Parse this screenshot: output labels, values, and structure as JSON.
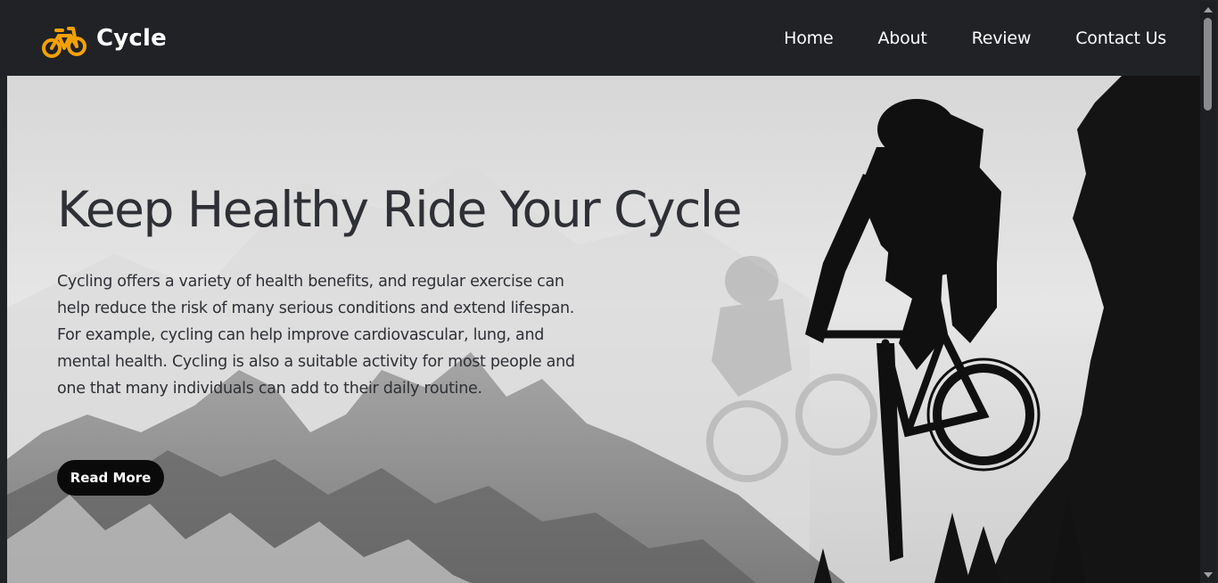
{
  "brand": {
    "name": "Cycle",
    "icon": "bicycle-icon",
    "icon_color": "#f5a100"
  },
  "nav": {
    "items": [
      {
        "label": "Home"
      },
      {
        "label": "About"
      },
      {
        "label": "Review"
      },
      {
        "label": "Contact Us"
      }
    ]
  },
  "hero": {
    "title": "Keep Healthy Ride Your Cycle",
    "description": "Cycling offers a variety of health benefits, and regular exercise can help reduce the risk of many serious conditions and extend lifespan. For example, cycling can help improve cardiovascular, lung, and mental health. Cycling is also a suitable activity for most people and one that many individuals can add to their daily routine.",
    "button_label": "Read More",
    "background": "mountain-biker-silhouette-photo"
  },
  "colors": {
    "navbar_bg": "#202226",
    "text_dark": "#2e3036",
    "button_bg": "#0a0a0a"
  }
}
